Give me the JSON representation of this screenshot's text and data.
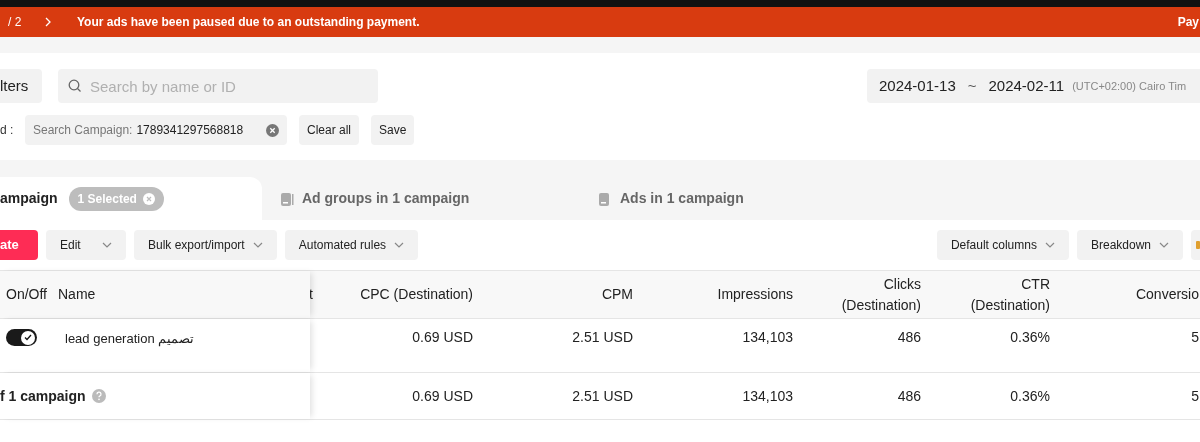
{
  "banner": {
    "pager": "/ 2",
    "message": "Your ads have been paused due to an outstanding payment.",
    "action": "Pay"
  },
  "filters": {
    "filters_button": "lters",
    "search": {
      "placeholder": "Search by name or ID"
    },
    "date_range": {
      "start": "2024-01-13",
      "separator": "~",
      "end": "2024-02-11",
      "timezone": "(UTC+02:00) Cairo Tim"
    }
  },
  "applied": {
    "label": "d :",
    "chips": [
      {
        "label": "Search Campaign:",
        "value": "1789341297568818"
      }
    ],
    "clear_all": "Clear all",
    "save": "Save"
  },
  "tabs": [
    {
      "label": "ampaign",
      "badge": "1 Selected",
      "selected": true
    },
    {
      "label": "Ad groups in 1 campaign",
      "selected": false
    },
    {
      "label": "Ads in 1 campaign",
      "selected": false
    }
  ],
  "toolbar": {
    "left": [
      {
        "label": "ate",
        "kind": "primary"
      },
      {
        "label": "Edit",
        "kind": "dropdown"
      },
      {
        "label": "Bulk export/import",
        "kind": "dropdown"
      },
      {
        "label": "Automated rules",
        "kind": "dropdown"
      }
    ],
    "right": [
      {
        "label": "Default columns",
        "kind": "dropdown"
      },
      {
        "label": "Breakdown",
        "kind": "dropdown"
      }
    ]
  },
  "table": {
    "columns": [
      "On/Off",
      "Name",
      "t",
      "CPC (Destination)",
      "CPM",
      "Impressions",
      "Clicks (Destination)",
      "CTR (Destination)",
      "Conversio"
    ],
    "rows": [
      {
        "on": true,
        "name": "lead generation تصميم",
        "values": [
          "0.69 USD",
          "2.51 USD",
          "134,103",
          "486",
          "0.36%",
          "5"
        ]
      }
    ],
    "total": {
      "label": "f 1 campaign",
      "values": [
        "0.69 USD",
        "2.51 USD",
        "134,103",
        "486",
        "0.36%",
        "5"
      ]
    }
  }
}
